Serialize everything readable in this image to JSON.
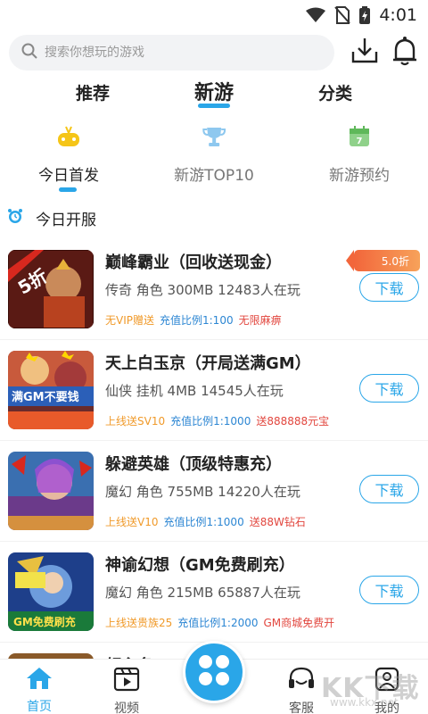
{
  "status_bar": {
    "time": "4:01"
  },
  "search": {
    "placeholder": "搜索你想玩的游戏"
  },
  "main_tabs": [
    {
      "label": "推荐"
    },
    {
      "label": "新游"
    },
    {
      "label": "分类"
    }
  ],
  "sub_tabs": [
    {
      "label": "今日首发",
      "icon": "gamepad-icon"
    },
    {
      "label": "新游TOP10",
      "icon": "trophy-icon"
    },
    {
      "label": "新游预约",
      "icon": "calendar-icon",
      "icon_text": "7"
    }
  ],
  "section": {
    "title": "今日开服",
    "icon": "alarm-clock-icon"
  },
  "games": [
    {
      "name": "巅峰霸业（回收送现金）",
      "meta": "传奇 角色 300MB 12483人在玩",
      "tags": [
        {
          "text": "无VIP赠送",
          "color": "orange"
        },
        {
          "text": "充值比例1:100",
          "color": "blue"
        },
        {
          "text": "无限麻痹",
          "color": "red"
        }
      ],
      "badge": "5.0折",
      "thumb_text": "5折",
      "download_label": "下载"
    },
    {
      "name": "天上白玉京（开局送满GM）",
      "meta": "仙侠 挂机 4MB 14545人在玩",
      "tags": [
        {
          "text": "上线送SV10",
          "color": "orange"
        },
        {
          "text": "充值比例1:1000",
          "color": "blue"
        },
        {
          "text": "送888888元宝",
          "color": "red"
        }
      ],
      "thumb_text": "满GM不要钱",
      "download_label": "下载"
    },
    {
      "name": "躲避英雄（顶级特惠充）",
      "meta": "魔幻 角色 755MB 14220人在玩",
      "tags": [
        {
          "text": "上线送V10",
          "color": "orange"
        },
        {
          "text": "充值比例1:1000",
          "color": "blue"
        },
        {
          "text": "送88W钻石",
          "color": "red"
        }
      ],
      "download_label": "下载"
    },
    {
      "name": "神谕幻想（GM免费刷充）",
      "meta": "魔幻 角色 215MB 65887人在玩",
      "tags": [
        {
          "text": "上线送贵族25",
          "color": "orange"
        },
        {
          "text": "充值比例1:2000",
          "color": "blue"
        },
        {
          "text": "GM商城免费开",
          "color": "red"
        }
      ],
      "thumb_text": "GM免费刷充",
      "download_label": "下载"
    },
    {
      "name": "领主名",
      "meta": "",
      "tags": [],
      "download_label": ""
    }
  ],
  "bottom_nav": [
    {
      "label": "首页",
      "icon": "home-icon"
    },
    {
      "label": "视频",
      "icon": "video-icon"
    },
    {
      "label": "",
      "icon": "apps-icon"
    },
    {
      "label": "客服",
      "icon": "headset-icon"
    },
    {
      "label": "我的",
      "icon": "profile-icon"
    }
  ],
  "watermark": {
    "text": "KK下载",
    "url": "www.kkx.net"
  },
  "colors": {
    "accent": "#2aa6e8",
    "tag_orange": "#f09a2a",
    "tag_blue": "#2c86d3",
    "tag_red": "#e2463e"
  }
}
